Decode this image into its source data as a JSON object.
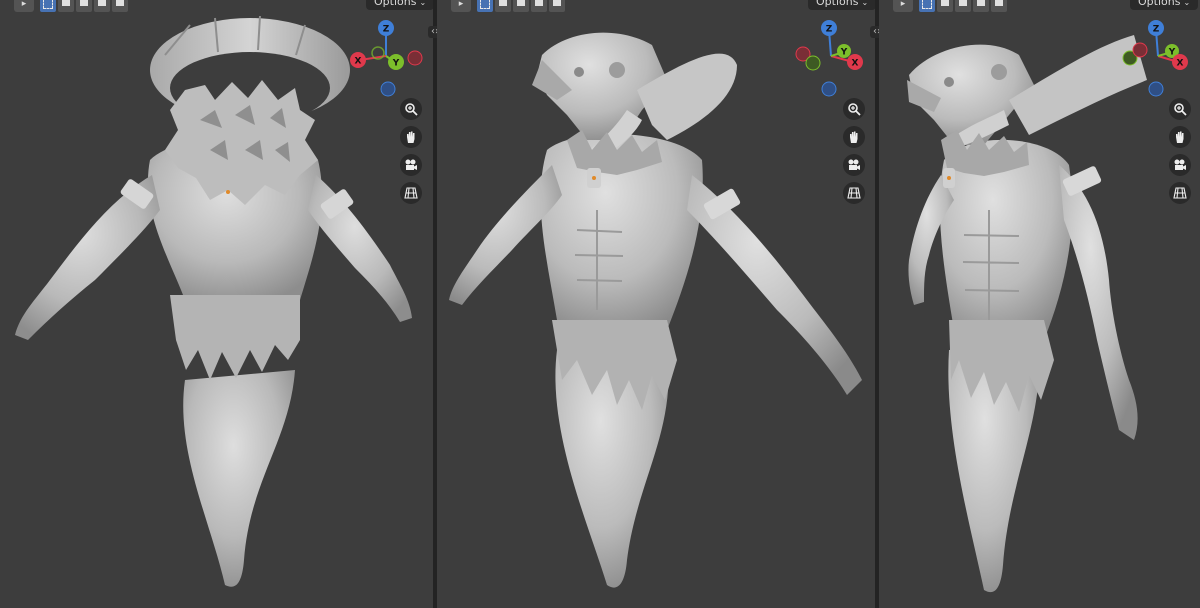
{
  "viewports": [
    {
      "name": "back-view",
      "options_label": "Options",
      "gizmo": {
        "x_label": "X",
        "y_label": "Y",
        "z_label": "Z"
      }
    },
    {
      "name": "front-three-quarter-view",
      "options_label": "Options",
      "gizmo": {
        "x_label": "X",
        "y_label": "Y",
        "z_label": "Z"
      }
    },
    {
      "name": "side-view",
      "options_label": "Options",
      "gizmo": {
        "x_label": "X",
        "y_label": "Y",
        "z_label": "Z"
      }
    }
  ],
  "nav_tools": [
    "zoom-icon",
    "pan-hand-icon",
    "camera-icon",
    "grid-perspective-icon"
  ],
  "colors": {
    "background": "#3d3d3d",
    "axis_x": "#e0394c",
    "axis_y": "#7cbf2b",
    "axis_z": "#3f7fd8",
    "clay": "#c9c9c9",
    "active_select": "#4772b3"
  }
}
